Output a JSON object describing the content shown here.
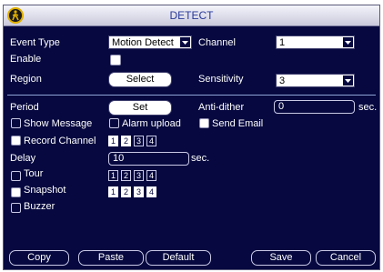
{
  "window": {
    "title": "DETECT"
  },
  "event_type": {
    "label": "Event Type",
    "value": "Motion Detect"
  },
  "channel": {
    "label": "Channel",
    "value": "1"
  },
  "enable": {
    "label": "Enable"
  },
  "region": {
    "label": "Region",
    "button": "Select"
  },
  "sensitivity": {
    "label": "Sensitivity",
    "value": "3"
  },
  "period": {
    "label": "Period",
    "button": "Set"
  },
  "anti_dither": {
    "label": "Anti-dither",
    "value": "0",
    "unit": "sec."
  },
  "show_message": {
    "label": "Show Message"
  },
  "alarm_upload": {
    "label": "Alarm upload"
  },
  "send_email": {
    "label": "Send Email"
  },
  "record_channel": {
    "label": "Record Channel",
    "channels": [
      "1",
      "2",
      "3",
      "4"
    ]
  },
  "delay": {
    "label": "Delay",
    "value": "10",
    "unit": "sec."
  },
  "tour": {
    "label": "Tour",
    "channels": [
      "1",
      "2",
      "3",
      "4"
    ]
  },
  "snapshot": {
    "label": "Snapshot",
    "channels": [
      "1",
      "2",
      "3",
      "4"
    ]
  },
  "buzzer": {
    "label": "Buzzer"
  },
  "buttons": {
    "copy": "Copy",
    "paste": "Paste",
    "default": "Default",
    "save": "Save",
    "cancel": "Cancel"
  },
  "colors": {
    "background": "#06083f",
    "title_text": "#2a3a9a",
    "accent": "#8ea4d6"
  }
}
